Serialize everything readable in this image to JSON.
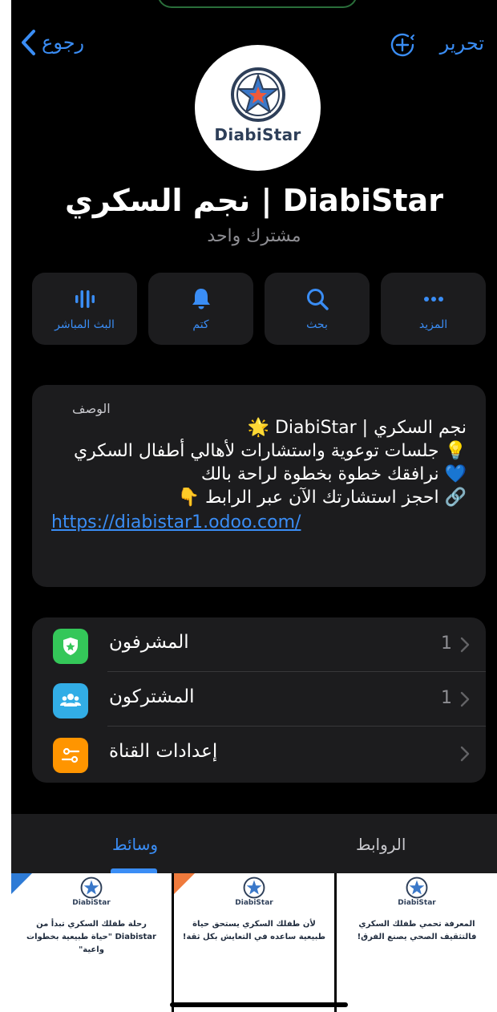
{
  "nav": {
    "back_label": "رجوع",
    "edit_label": "تحرير"
  },
  "channel": {
    "logo_text": "DiabiStar",
    "name": "نجم السكري | DiabiStar",
    "subscribers": "مشترك واحد"
  },
  "actions": [
    {
      "label": "البث المباشر",
      "icon": "live-stream-icon"
    },
    {
      "label": "كتم",
      "icon": "bell-icon"
    },
    {
      "label": "بحث",
      "icon": "search-icon"
    },
    {
      "label": "المزيد",
      "icon": "more-icon"
    }
  ],
  "description": {
    "label": "الوصف",
    "lines": [
      "نجم السكري | DiabiStar 🌟",
      "💡 جلسات توعوية واستشارات لأهالي أطفال السكري",
      "💙 نرافقك خطوة بخطوة لراحة بالك",
      "🔗 احجز استشارتك الآن عبر الرابط 👇"
    ],
    "link": "https://diabistar1.odoo.com/"
  },
  "settings": [
    {
      "label": "المشرفون",
      "count": "1",
      "icon": "shield-icon",
      "color": "#34c759"
    },
    {
      "label": "المشتركون",
      "count": "1",
      "icon": "people-icon",
      "color": "#32ade6"
    },
    {
      "label": "إعدادات القناة",
      "count": "",
      "icon": "sliders-icon",
      "color": "#ff9500"
    }
  ],
  "tabs": {
    "media": "وسائط",
    "links": "الروابط"
  },
  "media": [
    {
      "brand": "DiabiStar",
      "text": "رحلة طفلك السكري تبدأ من Diabistar \"حياة طبيعية بخطوات واعية\""
    },
    {
      "brand": "DiabiStar",
      "text": "لأن طفلك السكري يستحق حياة طبيعية ساعده في التعايش بكل ثقة!"
    },
    {
      "brand": "DiabiStar",
      "text": "المعرفة تحمي طفلك السكري فالتثقيف الصحي يصنع الفرق!"
    }
  ],
  "colors": {
    "accent": "#3a8df5",
    "background": "#000000",
    "card": "#1c1c1e"
  }
}
